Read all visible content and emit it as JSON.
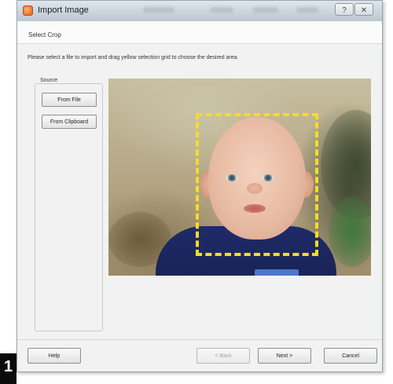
{
  "window": {
    "title": "Import Image",
    "help_glyph": "?",
    "close_glyph": "✕"
  },
  "header": {
    "step_title": "Select Crop"
  },
  "instruction": "Please select a file to import and drag yellow selection grid to choose the desired area.",
  "source": {
    "label": "Source",
    "from_file": "From File",
    "from_clipboard": "From Clipboard"
  },
  "crop": {
    "selection_color": "#f4dd24"
  },
  "footer": {
    "help": "Help",
    "back": "< Back",
    "next": "Next >",
    "cancel": "Cancel"
  },
  "figure_label": "1",
  "colors": {
    "titlebar": "#c9d3dc",
    "dialog_bg": "#f2f2f2"
  }
}
